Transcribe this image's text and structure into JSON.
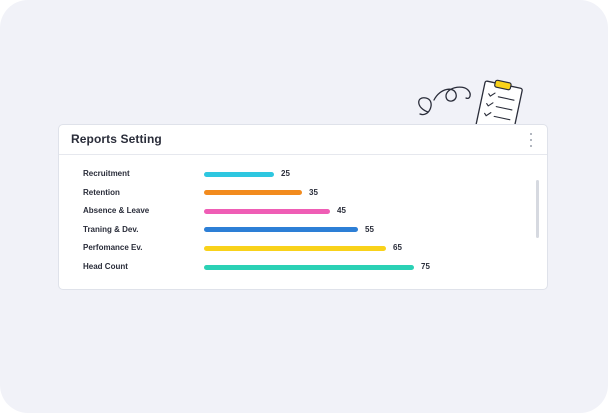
{
  "card": {
    "title": "Reports Setting",
    "menu_icon": "more-vertical-icon"
  },
  "decoration": {
    "icon": "clipboard-checklist-icon"
  },
  "colors": {
    "recruitment": "#2ec7e0",
    "retention": "#f28b1e",
    "absence": "#ef5db5",
    "training": "#2d7fd6",
    "performance": "#f9d21a",
    "headcount": "#2bd1b5"
  },
  "chart_data": {
    "type": "bar",
    "orientation": "horizontal",
    "categories": [
      "Recruitment",
      "Retention",
      "Absence & Leave",
      "Traning & Dev.",
      "Perfomance Ev.",
      "Head Count"
    ],
    "values": [
      25,
      35,
      45,
      55,
      65,
      75
    ],
    "value_labels": [
      "25",
      "35",
      "45",
      "55",
      "65",
      "75"
    ]
  }
}
